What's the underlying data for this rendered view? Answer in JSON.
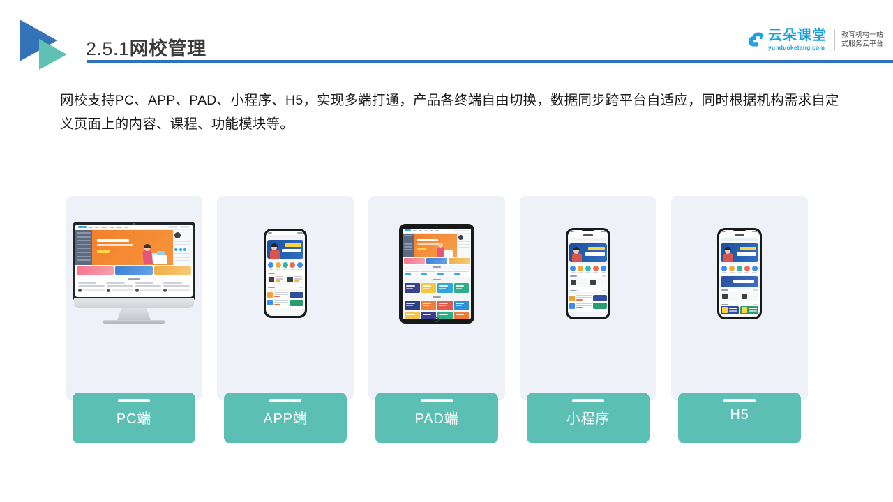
{
  "header": {
    "section_number": "2.5.1",
    "title_cn": "网校管理",
    "rule_color": "#3073b5",
    "logo_triangle_blue": "#3573b9",
    "logo_triangle_teal": "#5fc0b4"
  },
  "brand": {
    "name_cn": "云朵课堂",
    "domain": "yunduoketang.com",
    "tagline_line1": "教育机构一站",
    "tagline_line2": "式服务云平台",
    "color": "#1b9fe0"
  },
  "body": {
    "paragraph": "网校支持PC、APP、PAD、小程序、H5，实现多端打通，产品各终端自由切换，数据同步跨平台自适应，同时根据机构需求自定义页面上的内容、课程、功能模块等。"
  },
  "cards": {
    "label_bg": "#5cbfb4",
    "card_bg": "#eef1f8",
    "items": [
      {
        "label": "PC端",
        "device": "desktop-monitor"
      },
      {
        "label": "APP端",
        "device": "smartphone"
      },
      {
        "label": "PAD端",
        "device": "tablet"
      },
      {
        "label": "小程序",
        "device": "smartphone"
      },
      {
        "label": "H5",
        "device": "smartphone"
      }
    ]
  }
}
